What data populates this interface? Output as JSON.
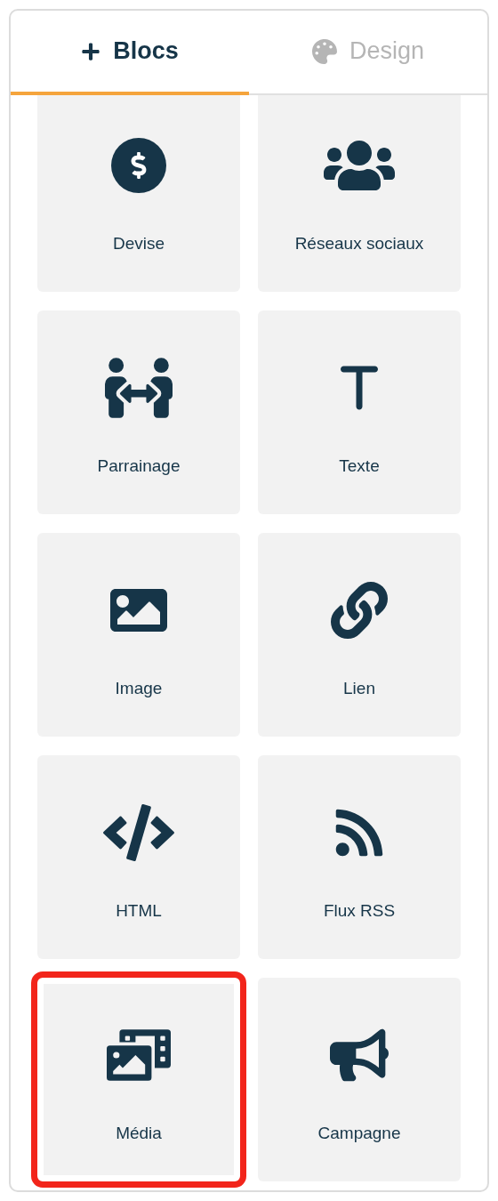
{
  "tabs": [
    {
      "label": "Blocs",
      "selected": true
    },
    {
      "label": "Design",
      "selected": false
    }
  ],
  "blocks": [
    {
      "label": "Devise",
      "highlighted": false
    },
    {
      "label": "Réseaux sociaux",
      "highlighted": false
    },
    {
      "label": "Parrainage",
      "highlighted": false
    },
    {
      "label": "Texte",
      "highlighted": false
    },
    {
      "label": "Image",
      "highlighted": false
    },
    {
      "label": "Lien",
      "highlighted": false
    },
    {
      "label": "HTML",
      "highlighted": false
    },
    {
      "label": "Flux RSS",
      "highlighted": false
    },
    {
      "label": "Média",
      "highlighted": true
    },
    {
      "label": "Campagne",
      "highlighted": false
    }
  ]
}
